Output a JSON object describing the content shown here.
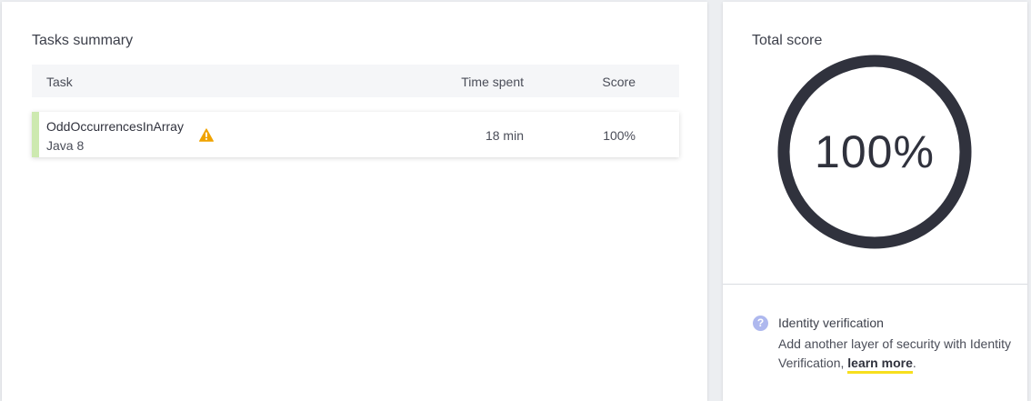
{
  "tasks_summary": {
    "title": "Tasks summary",
    "columns": {
      "task": "Task",
      "time_spent": "Time spent",
      "score": "Score"
    },
    "rows": [
      {
        "name": "OddOccurrencesInArray",
        "language": "Java 8",
        "time_spent": "18 min",
        "score": "100%",
        "icon": "warning-icon",
        "accent_color": "#cde9b0"
      }
    ]
  },
  "total_score": {
    "title": "Total score",
    "value": "100%",
    "fraction": 1.0,
    "ring_color": "#30323d"
  },
  "identity_verification": {
    "icon": "help-icon",
    "icon_glyph": "?",
    "title": "Identity verification",
    "text_before_link": "Add another layer of security with Identity Verification, ",
    "link_label": "learn more",
    "text_after_link": ".",
    "link_underline_color": "#f7df1e"
  }
}
